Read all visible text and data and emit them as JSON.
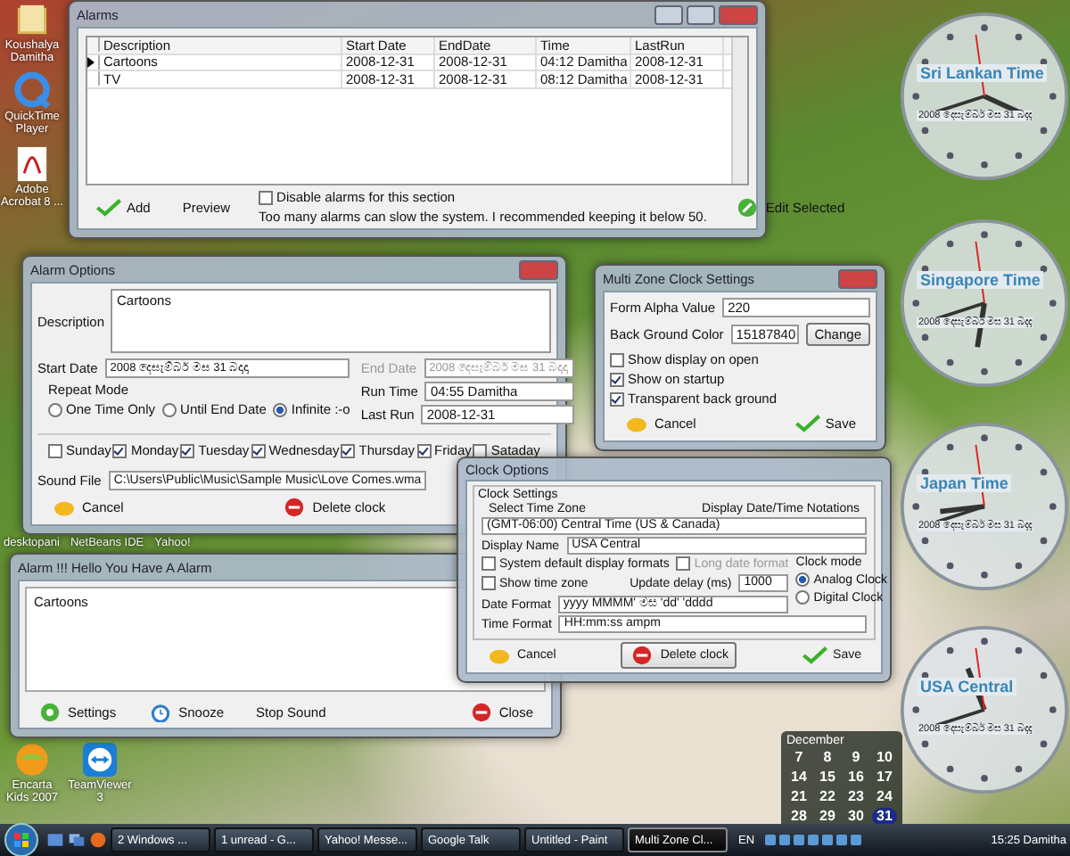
{
  "desktop_icons": [
    {
      "label": "Koushalya Damitha",
      "kind": "folder"
    },
    {
      "label": "QuickTime Player",
      "kind": "quicktime"
    },
    {
      "label": "Adobe Acrobat 8 ...",
      "kind": "pdf"
    }
  ],
  "bottom_icons": [
    {
      "label": "Encarta Kids 2007",
      "kind": "globe"
    },
    {
      "label": "TeamViewer 3",
      "kind": "teamviewer"
    }
  ],
  "launch_strip": [
    "desktopani",
    "NetBeans IDE",
    "Yahoo!"
  ],
  "alarms_window": {
    "title": "Alarms",
    "columns": [
      "Description",
      "Start Date",
      "EndDate",
      "Time",
      "LastRun"
    ],
    "rows": [
      {
        "selected": true,
        "cells": [
          "Cartoons",
          "2008-12-31",
          "2008-12-31",
          "04:12 Damitha",
          "2008-12-31"
        ]
      },
      {
        "selected": false,
        "cells": [
          "TV",
          "2008-12-31",
          "2008-12-31",
          "08:12 Damitha",
          "2008-12-31"
        ]
      }
    ],
    "add": "Add",
    "preview": "Preview",
    "disable": {
      "label": "Disable alarms for this section",
      "checked": false
    },
    "note": "Too many alarms can slow the system.  I recommended keeping it below 50.",
    "edit": "Edit Selected"
  },
  "alarm_options": {
    "title": "Alarm Options",
    "description_label": "Description",
    "description": "Cartoons",
    "start_date_label": "Start Date",
    "start_date": "2008 දෙසැම්බර් මස 31 බදාදා",
    "end_date_label": "End Date",
    "end_date": "2008 දෙසැම්බර් මස 31 බදාදා",
    "end_disabled": true,
    "repeat_label": "Repeat Mode",
    "repeat_modes": [
      {
        "label": "One Time Only",
        "selected": false
      },
      {
        "label": "Until End Date",
        "selected": false
      },
      {
        "label": "Infinite :-o",
        "selected": true
      }
    ],
    "run_time_label": "Run Time",
    "run_time": "04:55  Damitha",
    "last_run_label": "Last Run",
    "last_run": "2008-12-31",
    "days": [
      {
        "label": "Sunday",
        "checked": false
      },
      {
        "label": "Monday",
        "checked": true
      },
      {
        "label": "Tuesday",
        "checked": true
      },
      {
        "label": "Wednesday",
        "checked": true
      },
      {
        "label": "Thursday",
        "checked": true
      },
      {
        "label": "Friday",
        "checked": true
      },
      {
        "label": "Sataday",
        "checked": false
      }
    ],
    "sound_label": "Sound File",
    "sound_file": "C:\\Users\\Public\\Music\\Sample Music\\Love Comes.wma",
    "cancel": "Cancel",
    "delete": "Delete clock"
  },
  "clock_settings": {
    "title": "Multi Zone Clock Settings",
    "alpha_label": "Form Alpha Value",
    "alpha": "220",
    "color_label": "Back Ground Color",
    "back_ground_value": "15187840",
    "change": "Change",
    "options": [
      {
        "label": "Show display on open",
        "checked": false
      },
      {
        "label": "Show on startup",
        "checked": true
      },
      {
        "label": "Transparent back ground",
        "checked": true
      }
    ],
    "cancel": "Cancel",
    "save": "Save"
  },
  "alert_window": {
    "title": "Alarm !!! Hello You Have A Alarm",
    "message": "Cartoons",
    "settings": "Settings",
    "snooze": "Snooze",
    "stop": "Stop Sound",
    "close": "Close"
  },
  "clock_options": {
    "title": "Clock Options",
    "group": "Clock Settings",
    "tz_label": "Select Time Zone",
    "notations": "Display Date/Time Notations",
    "tz": "(GMT-06:00) Central Time (US & Canada)",
    "name_label": "Display Name",
    "name": "USA Central",
    "system_default": {
      "label": "System default display formats",
      "checked": false
    },
    "long_date": {
      "label": "Long date format",
      "checked": false,
      "disabled": true
    },
    "show_tz": {
      "label": "Show time zone",
      "checked": false
    },
    "delay_label": "Update delay (ms)",
    "delay": "1000",
    "mode_label": "Clock mode",
    "modes": [
      {
        "label": "Analog Clock",
        "selected": true
      },
      {
        "label": "Digital Clock",
        "selected": false
      }
    ],
    "date_format_label": "Date Format",
    "date_format": "yyyy MMMM' මස 'dd' 'dddd",
    "time_format_label": "Time Format",
    "time_format": "HH:mm:ss ampm",
    "cancel": "Cancel",
    "delete": "Delete clock",
    "save": "Save"
  },
  "clocks": [
    {
      "label": "Sri Lankan Time",
      "date": "2008 දෙසැම්බර් මස 31 බදාදා"
    },
    {
      "label": "Singapore Time",
      "date": "2008 දෙසැම්බර් මස 31 බදාදා"
    },
    {
      "label": "Japan Time",
      "date": "2008 දෙසැම්බර් මස 31 බදාදා"
    },
    {
      "label": "USA Central",
      "date": "2008 දෙසැම්බර් මස 31 බදාදා"
    }
  ],
  "calendar": {
    "month": "December",
    "weeks": [
      [
        {
          "day": "7",
          "selected": false
        },
        {
          "day": "8",
          "selected": false
        },
        {
          "day": "9",
          "selected": false
        },
        {
          "day": "10",
          "selected": false
        }
      ],
      [
        {
          "day": "14",
          "selected": false
        },
        {
          "day": "15",
          "selected": false
        },
        {
          "day": "16",
          "selected": false
        },
        {
          "day": "17",
          "selected": false
        }
      ],
      [
        {
          "day": "21",
          "selected": false
        },
        {
          "day": "22",
          "selected": false
        },
        {
          "day": "23",
          "selected": false
        },
        {
          "day": "24",
          "selected": false
        }
      ],
      [
        {
          "day": "28",
          "selected": false
        },
        {
          "day": "29",
          "selected": false
        },
        {
          "day": "30",
          "selected": false
        },
        {
          "day": "31",
          "selected": true
        }
      ]
    ]
  },
  "taskbar": {
    "tasks": [
      {
        "label": "2 Windows ...",
        "selected": false
      },
      {
        "label": "1 unread - G...",
        "selected": false
      },
      {
        "label": "Yahoo! Messe...",
        "selected": false
      },
      {
        "label": "Google Talk",
        "selected": false
      },
      {
        "label": "Untitled - Paint",
        "selected": false
      },
      {
        "label": "Multi Zone Cl...",
        "selected": true
      }
    ],
    "lang": "EN",
    "clock": "15:25 Damitha"
  }
}
